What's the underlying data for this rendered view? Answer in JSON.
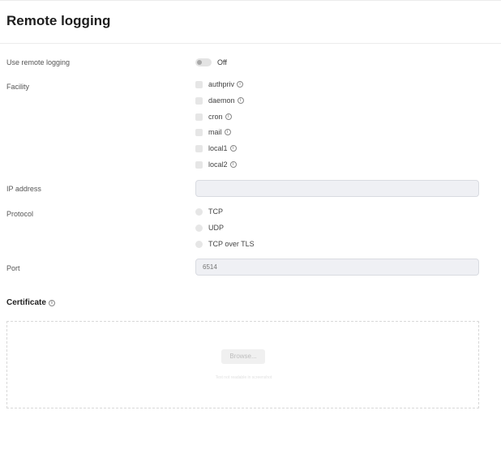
{
  "header": {
    "title": "Remote logging"
  },
  "use_remote_logging": {
    "label": "Use remote logging",
    "state": "Off"
  },
  "facility": {
    "label": "Facility",
    "options": [
      {
        "label": "authpriv",
        "checked": false
      },
      {
        "label": "daemon",
        "checked": false
      },
      {
        "label": "cron",
        "checked": false
      },
      {
        "label": "mail",
        "checked": false
      },
      {
        "label": "local1",
        "checked": false
      },
      {
        "label": "local2",
        "checked": false
      }
    ]
  },
  "ip_address": {
    "label": "IP address",
    "value": "",
    "placeholder": ""
  },
  "protocol": {
    "label": "Protocol",
    "options": [
      {
        "label": "TCP",
        "selected": false
      },
      {
        "label": "UDP",
        "selected": false
      },
      {
        "label": "TCP over TLS",
        "selected": false
      }
    ]
  },
  "port": {
    "label": "Port",
    "placeholder": "6514"
  },
  "certificate": {
    "title": "Certificate",
    "browse_label": "Browse...",
    "hint": "Text not readable in screenshot"
  },
  "icons": {
    "info": "info-icon",
    "toggle": "toggle-switch"
  }
}
